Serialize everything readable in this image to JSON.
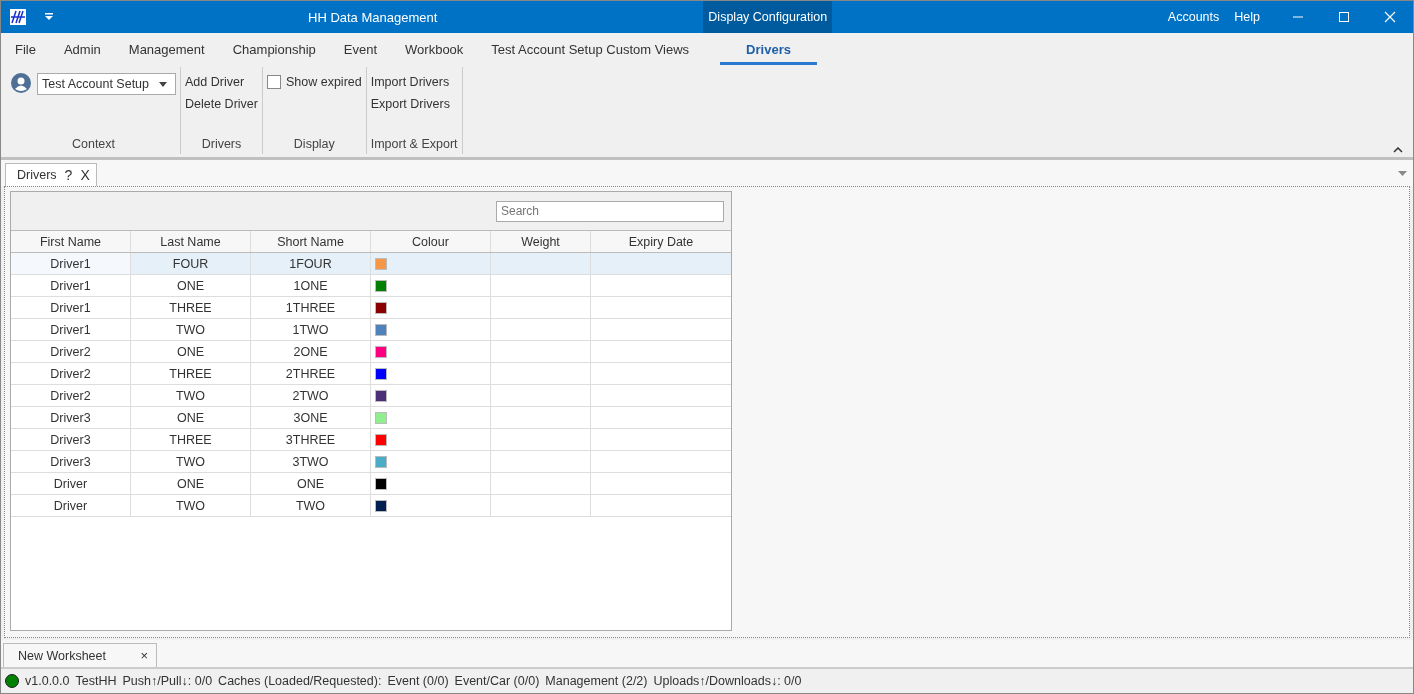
{
  "window": {
    "title": "HH Data Management",
    "context_tab": "Display Configuration",
    "links": [
      "Accounts",
      "Help"
    ]
  },
  "menu": [
    {
      "label": "File",
      "selected": false
    },
    {
      "label": "Admin",
      "selected": false
    },
    {
      "label": "Management",
      "selected": false
    },
    {
      "label": "Championship",
      "selected": false
    },
    {
      "label": "Event",
      "selected": false
    },
    {
      "label": "Workbook",
      "selected": false
    },
    {
      "label": "Test Account Setup Custom Views",
      "selected": false
    },
    {
      "label": "Drivers",
      "selected": true
    }
  ],
  "ribbon": {
    "context": {
      "value": "Test Account Setup",
      "label": "Context"
    },
    "drivers": {
      "buttons": [
        "Add Driver",
        "Delete Driver"
      ],
      "label": "Drivers"
    },
    "display": {
      "checkbox": "Show expired",
      "checked": false,
      "label": "Display"
    },
    "import_export": {
      "buttons": [
        "Import Drivers",
        "Export Drivers"
      ],
      "label": "Import & Export"
    }
  },
  "doc_tab": {
    "label": "Drivers",
    "help": "?",
    "close": "X"
  },
  "search": {
    "placeholder": "Search"
  },
  "table": {
    "columns": [
      "First Name",
      "Last Name",
      "Short Name",
      "Colour",
      "Weight",
      "Expiry Date"
    ],
    "rows": [
      {
        "first": "Driver1",
        "last": "FOUR",
        "short": "1FOUR",
        "color": "#f79646",
        "selected": true
      },
      {
        "first": "Driver1",
        "last": "ONE",
        "short": "1ONE",
        "color": "#008000",
        "selected": false
      },
      {
        "first": "Driver1",
        "last": "THREE",
        "short": "1THREE",
        "color": "#8b0000",
        "selected": false
      },
      {
        "first": "Driver1",
        "last": "TWO",
        "short": "1TWO",
        "color": "#4f81bd",
        "selected": false
      },
      {
        "first": "Driver2",
        "last": "ONE",
        "short": "2ONE",
        "color": "#ff0080",
        "selected": false
      },
      {
        "first": "Driver2",
        "last": "THREE",
        "short": "2THREE",
        "color": "#0000ff",
        "selected": false
      },
      {
        "first": "Driver2",
        "last": "TWO",
        "short": "2TWO",
        "color": "#4b3078",
        "selected": false
      },
      {
        "first": "Driver3",
        "last": "ONE",
        "short": "3ONE",
        "color": "#90ee90",
        "selected": false
      },
      {
        "first": "Driver3",
        "last": "THREE",
        "short": "3THREE",
        "color": "#ff0000",
        "selected": false
      },
      {
        "first": "Driver3",
        "last": "TWO",
        "short": "3TWO",
        "color": "#4bacc6",
        "selected": false
      },
      {
        "first": "Driver",
        "last": "ONE",
        "short": "ONE",
        "color": "#000000",
        "selected": false
      },
      {
        "first": "Driver",
        "last": "TWO",
        "short": "TWO",
        "color": "#002050",
        "selected": false
      }
    ]
  },
  "worksheet_tab": {
    "label": "New Worksheet",
    "close": "×"
  },
  "status_bar": {
    "connected": true,
    "items": [
      "v1.0.0.0",
      "TestHH",
      "Push↑/Pull↓: 0/0",
      "Caches (Loaded/Requested):",
      "Event (0/0)",
      "Event/Car (0/0)",
      "Management (2/2)",
      "Uploads↑/Downloads↓: 0/0"
    ]
  }
}
